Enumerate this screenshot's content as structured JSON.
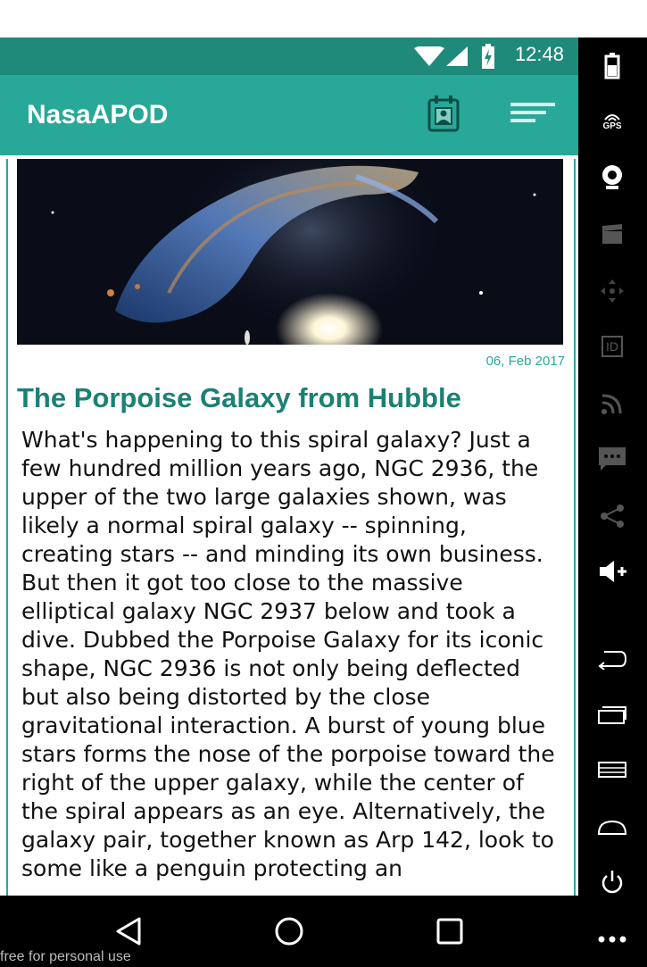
{
  "status_bar": {
    "time": "12:48"
  },
  "app_bar": {
    "title": "NasaAPOD",
    "calendar_icon": "calendar-icon",
    "menu_icon": "sort-menu-icon"
  },
  "apod": {
    "date": "06, Feb 2017",
    "title": "The Porpoise Galaxy from Hubble",
    "explanation": "What's happening to this spiral galaxy? Just a few hundred million years ago, NGC 2936, the upper of the two large galaxies shown, was likely a normal spiral galaxy -- spinning, creating stars -- and minding its own business. But then it got too close to the massive elliptical galaxy NGC 2937 below and took a dive. Dubbed the Porpoise Galaxy for its iconic shape, NGC 2936 is not only being deflected but also being distorted by the close gravitational interaction. A burst of young blue stars forms the nose of the porpoise toward the right of the upper galaxy, while the center of the spiral appears as an eye.  Alternatively, the galaxy pair, together known as Arp 142, look to some like a penguin protecting an"
  },
  "nav_bar": {
    "back_icon": "back-icon",
    "home_icon": "home-icon",
    "recents_icon": "recents-icon"
  },
  "emulator_sidebar": {
    "icons": [
      "battery-icon",
      "gps-icon",
      "camera-icon",
      "clapper-icon",
      "dpad-icon",
      "id-icon",
      "rss-icon",
      "message-icon",
      "share-icon",
      "volume-up-icon",
      "back-icon",
      "recents-icon",
      "menu-icon",
      "home-icon",
      "power-icon",
      "more-icon"
    ],
    "gps_label": "GPS",
    "id_label": "ID"
  },
  "watermark": "free for personal use"
}
